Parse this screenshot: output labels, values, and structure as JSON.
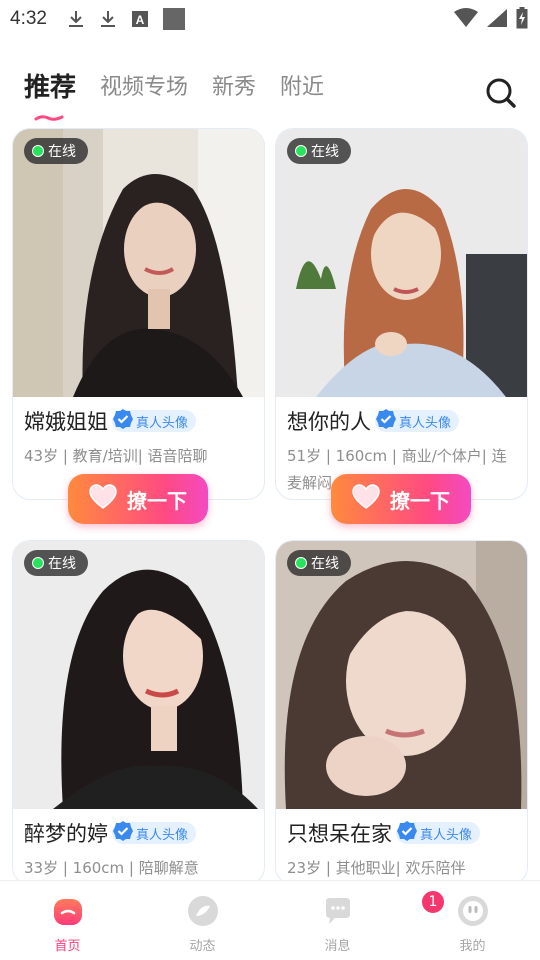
{
  "status_bar": {
    "time": "4:32",
    "icons": [
      "download-icon",
      "download-icon",
      "a-box-icon",
      "square-icon"
    ],
    "right_icons": [
      "wifi-icon",
      "signal-icon",
      "battery-icon"
    ]
  },
  "tabs": [
    {
      "label": "推荐",
      "active": true
    },
    {
      "label": "视频专场",
      "active": false
    },
    {
      "label": "新秀",
      "active": false
    },
    {
      "label": "附近",
      "active": false
    }
  ],
  "search_icon": "search-icon",
  "cards": [
    {
      "online": "在线",
      "name": "嫦娥姐姐",
      "verified": "真人头像",
      "desc": "43岁 | 教育/培训| 语音陪聊",
      "like": "撩一下"
    },
    {
      "online": "在线",
      "name": "想你的人",
      "verified": "真人头像",
      "desc": "51岁 | 160cm | 商业/个体户| 连麦解闷",
      "like": "撩一下"
    },
    {
      "online": "在线",
      "name": "醉梦的婷",
      "verified": "真人头像",
      "desc": "33岁 | 160cm | 陪聊解意",
      "like": ""
    },
    {
      "online": "在线",
      "name": "只想呆在家",
      "verified": "真人头像",
      "desc": "23岁 | 其他职业| 欢乐陪伴",
      "like": ""
    }
  ],
  "nav": [
    {
      "label": "首页",
      "icon": "home-icon",
      "active": true
    },
    {
      "label": "动态",
      "icon": "feed-icon",
      "active": false
    },
    {
      "label": "消息",
      "icon": "message-icon",
      "active": false,
      "badge": "1"
    },
    {
      "label": "我的",
      "icon": "profile-icon",
      "active": false
    }
  ],
  "colors": {
    "accent": "#ff3c7a",
    "online": "#27e35d",
    "verified": "#3a89ee"
  }
}
